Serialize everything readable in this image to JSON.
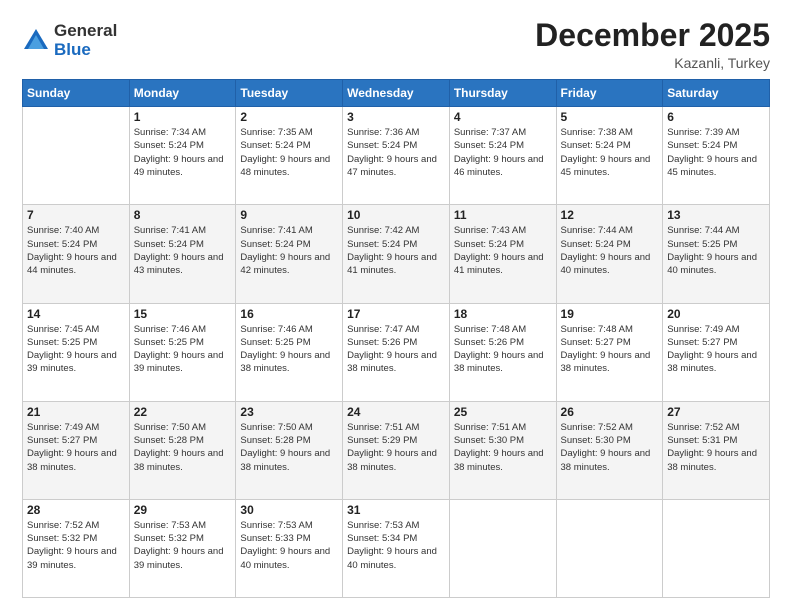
{
  "logo": {
    "general": "General",
    "blue": "Blue"
  },
  "title": "December 2025",
  "location": "Kazanli, Turkey",
  "days_of_week": [
    "Sunday",
    "Monday",
    "Tuesday",
    "Wednesday",
    "Thursday",
    "Friday",
    "Saturday"
  ],
  "weeks": [
    [
      {
        "day": "",
        "sunrise": "",
        "sunset": "",
        "daylight": ""
      },
      {
        "day": "1",
        "sunrise": "Sunrise: 7:34 AM",
        "sunset": "Sunset: 5:24 PM",
        "daylight": "Daylight: 9 hours and 49 minutes."
      },
      {
        "day": "2",
        "sunrise": "Sunrise: 7:35 AM",
        "sunset": "Sunset: 5:24 PM",
        "daylight": "Daylight: 9 hours and 48 minutes."
      },
      {
        "day": "3",
        "sunrise": "Sunrise: 7:36 AM",
        "sunset": "Sunset: 5:24 PM",
        "daylight": "Daylight: 9 hours and 47 minutes."
      },
      {
        "day": "4",
        "sunrise": "Sunrise: 7:37 AM",
        "sunset": "Sunset: 5:24 PM",
        "daylight": "Daylight: 9 hours and 46 minutes."
      },
      {
        "day": "5",
        "sunrise": "Sunrise: 7:38 AM",
        "sunset": "Sunset: 5:24 PM",
        "daylight": "Daylight: 9 hours and 45 minutes."
      },
      {
        "day": "6",
        "sunrise": "Sunrise: 7:39 AM",
        "sunset": "Sunset: 5:24 PM",
        "daylight": "Daylight: 9 hours and 45 minutes."
      }
    ],
    [
      {
        "day": "7",
        "sunrise": "Sunrise: 7:40 AM",
        "sunset": "Sunset: 5:24 PM",
        "daylight": "Daylight: 9 hours and 44 minutes."
      },
      {
        "day": "8",
        "sunrise": "Sunrise: 7:41 AM",
        "sunset": "Sunset: 5:24 PM",
        "daylight": "Daylight: 9 hours and 43 minutes."
      },
      {
        "day": "9",
        "sunrise": "Sunrise: 7:41 AM",
        "sunset": "Sunset: 5:24 PM",
        "daylight": "Daylight: 9 hours and 42 minutes."
      },
      {
        "day": "10",
        "sunrise": "Sunrise: 7:42 AM",
        "sunset": "Sunset: 5:24 PM",
        "daylight": "Daylight: 9 hours and 41 minutes."
      },
      {
        "day": "11",
        "sunrise": "Sunrise: 7:43 AM",
        "sunset": "Sunset: 5:24 PM",
        "daylight": "Daylight: 9 hours and 41 minutes."
      },
      {
        "day": "12",
        "sunrise": "Sunrise: 7:44 AM",
        "sunset": "Sunset: 5:24 PM",
        "daylight": "Daylight: 9 hours and 40 minutes."
      },
      {
        "day": "13",
        "sunrise": "Sunrise: 7:44 AM",
        "sunset": "Sunset: 5:25 PM",
        "daylight": "Daylight: 9 hours and 40 minutes."
      }
    ],
    [
      {
        "day": "14",
        "sunrise": "Sunrise: 7:45 AM",
        "sunset": "Sunset: 5:25 PM",
        "daylight": "Daylight: 9 hours and 39 minutes."
      },
      {
        "day": "15",
        "sunrise": "Sunrise: 7:46 AM",
        "sunset": "Sunset: 5:25 PM",
        "daylight": "Daylight: 9 hours and 39 minutes."
      },
      {
        "day": "16",
        "sunrise": "Sunrise: 7:46 AM",
        "sunset": "Sunset: 5:25 PM",
        "daylight": "Daylight: 9 hours and 38 minutes."
      },
      {
        "day": "17",
        "sunrise": "Sunrise: 7:47 AM",
        "sunset": "Sunset: 5:26 PM",
        "daylight": "Daylight: 9 hours and 38 minutes."
      },
      {
        "day": "18",
        "sunrise": "Sunrise: 7:48 AM",
        "sunset": "Sunset: 5:26 PM",
        "daylight": "Daylight: 9 hours and 38 minutes."
      },
      {
        "day": "19",
        "sunrise": "Sunrise: 7:48 AM",
        "sunset": "Sunset: 5:27 PM",
        "daylight": "Daylight: 9 hours and 38 minutes."
      },
      {
        "day": "20",
        "sunrise": "Sunrise: 7:49 AM",
        "sunset": "Sunset: 5:27 PM",
        "daylight": "Daylight: 9 hours and 38 minutes."
      }
    ],
    [
      {
        "day": "21",
        "sunrise": "Sunrise: 7:49 AM",
        "sunset": "Sunset: 5:27 PM",
        "daylight": "Daylight: 9 hours and 38 minutes."
      },
      {
        "day": "22",
        "sunrise": "Sunrise: 7:50 AM",
        "sunset": "Sunset: 5:28 PM",
        "daylight": "Daylight: 9 hours and 38 minutes."
      },
      {
        "day": "23",
        "sunrise": "Sunrise: 7:50 AM",
        "sunset": "Sunset: 5:28 PM",
        "daylight": "Daylight: 9 hours and 38 minutes."
      },
      {
        "day": "24",
        "sunrise": "Sunrise: 7:51 AM",
        "sunset": "Sunset: 5:29 PM",
        "daylight": "Daylight: 9 hours and 38 minutes."
      },
      {
        "day": "25",
        "sunrise": "Sunrise: 7:51 AM",
        "sunset": "Sunset: 5:30 PM",
        "daylight": "Daylight: 9 hours and 38 minutes."
      },
      {
        "day": "26",
        "sunrise": "Sunrise: 7:52 AM",
        "sunset": "Sunset: 5:30 PM",
        "daylight": "Daylight: 9 hours and 38 minutes."
      },
      {
        "day": "27",
        "sunrise": "Sunrise: 7:52 AM",
        "sunset": "Sunset: 5:31 PM",
        "daylight": "Daylight: 9 hours and 38 minutes."
      }
    ],
    [
      {
        "day": "28",
        "sunrise": "Sunrise: 7:52 AM",
        "sunset": "Sunset: 5:32 PM",
        "daylight": "Daylight: 9 hours and 39 minutes."
      },
      {
        "day": "29",
        "sunrise": "Sunrise: 7:53 AM",
        "sunset": "Sunset: 5:32 PM",
        "daylight": "Daylight: 9 hours and 39 minutes."
      },
      {
        "day": "30",
        "sunrise": "Sunrise: 7:53 AM",
        "sunset": "Sunset: 5:33 PM",
        "daylight": "Daylight: 9 hours and 40 minutes."
      },
      {
        "day": "31",
        "sunrise": "Sunrise: 7:53 AM",
        "sunset": "Sunset: 5:34 PM",
        "daylight": "Daylight: 9 hours and 40 minutes."
      },
      {
        "day": "",
        "sunrise": "",
        "sunset": "",
        "daylight": ""
      },
      {
        "day": "",
        "sunrise": "",
        "sunset": "",
        "daylight": ""
      },
      {
        "day": "",
        "sunrise": "",
        "sunset": "",
        "daylight": ""
      }
    ]
  ]
}
